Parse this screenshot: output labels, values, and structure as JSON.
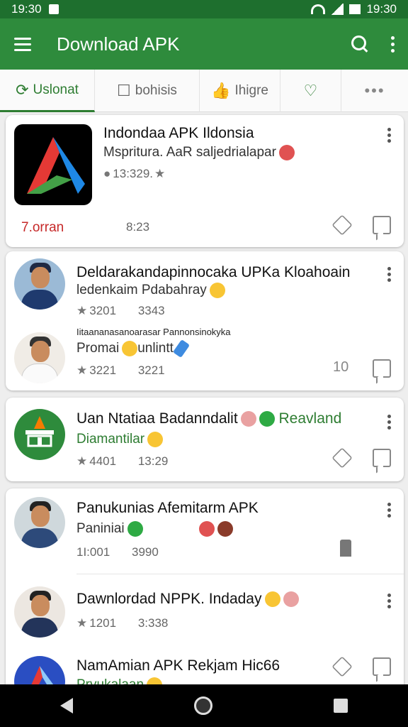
{
  "status": {
    "time_left": "19:30",
    "time_right": "19:30"
  },
  "appbar": {
    "title": "Download APK"
  },
  "tabs": [
    {
      "label": "Uslonat"
    },
    {
      "label": "bohisis"
    },
    {
      "label": "Ihigre"
    }
  ],
  "tab_more": "•••",
  "colors": {
    "appbar": "#2e8b3c",
    "statusbar": "#1e6f2e",
    "accent": "#2e7d32"
  },
  "cards": [
    {
      "title": "Indondaa APK Ildonsia",
      "subtitle": "Mspritura. AaR saljedrialapar",
      "rating": "13:329.",
      "footer_left": "7.orran",
      "footer_mid": "8:23"
    },
    {
      "posts": [
        {
          "title": "Deldarakandapinnocaka UPKa Kloahoain",
          "subtitle": "ledenkaim Pdabahray",
          "rating": "3201",
          "count": "3343"
        },
        {
          "caption": "Iitaananasanoarasar Pannonsinokyka",
          "subtitle": "Promai",
          "subtitle2": "unlintt",
          "rating": "3221",
          "count": "3221",
          "action_count": "10"
        }
      ]
    },
    {
      "title": "Uan Ntatiaa Badanndalit",
      "title_extra": "Reavland",
      "subtitle": "Diamantilar",
      "rating": "4401",
      "count": "13:29"
    },
    {
      "posts": [
        {
          "title": "Panukunias Afemitarm APK",
          "subtitle": "Paniniai",
          "rating": "1I:001",
          "count": "3990"
        },
        {
          "title": "Dawnlordad NPPK. Indaday",
          "rating": "1201",
          "count": "3:338"
        },
        {
          "title": "NamAmian APK Rekjam Hic66",
          "subtitle": "Prvukalaan"
        }
      ]
    }
  ]
}
